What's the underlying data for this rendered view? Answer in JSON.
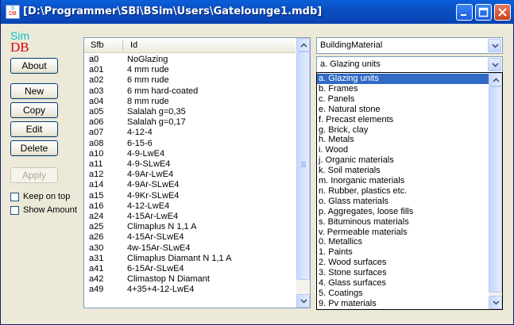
{
  "window": {
    "title": "[D:\\Programmer\\SBi\\BSim\\Users\\Gatelounge1.mdb]"
  },
  "logo": {
    "line1": "Sim",
    "line2": "DB"
  },
  "buttons": {
    "about": "About",
    "new": "New",
    "copy": "Copy",
    "edit": "Edit",
    "delete": "Delete",
    "apply": "Apply"
  },
  "checkboxes": {
    "keep_on_top": "Keep on top",
    "show_amount": "Show Amount"
  },
  "list": {
    "columns": [
      "Sfb",
      "Id"
    ],
    "rows": [
      [
        "a0",
        "NoGlazing"
      ],
      [
        "a01",
        "4 mm rude"
      ],
      [
        "a02",
        "6 mm rude"
      ],
      [
        "a03",
        "6 mm hard-coated"
      ],
      [
        "a04",
        "8 mm rude"
      ],
      [
        "a05",
        "Salalah g=0,35"
      ],
      [
        "a06",
        "Salalah g=0,17"
      ],
      [
        "a07",
        "4-12-4"
      ],
      [
        "a08",
        "6-15-6"
      ],
      [
        "a10",
        "4-9-LwE4"
      ],
      [
        "a11",
        "4-9-SLwE4"
      ],
      [
        "a12",
        "4-9Ar-LwE4"
      ],
      [
        "a14",
        "4-9Ar-SLwE4"
      ],
      [
        "a15",
        "4-9Kr-SLwE4"
      ],
      [
        "a16",
        "4-12-LwE4"
      ],
      [
        "a24",
        "4-15Ar-LwE4"
      ],
      [
        "a25",
        "Climaplus N 1,1 A"
      ],
      [
        "a26",
        "4-15Ar-SLwE4"
      ],
      [
        "a30",
        "4w-15Ar-SLwE4"
      ],
      [
        "a31",
        "Climaplus Diamant N 1,1 A"
      ],
      [
        "a41",
        "6-15Ar-SLwE4"
      ],
      [
        "a42",
        "Climastop N Diamant"
      ],
      [
        "a49",
        "4+35+4-12-LwE4"
      ]
    ]
  },
  "combo_table": {
    "value": "BuildingMaterial"
  },
  "combo_category": {
    "value": "a. Glazing units"
  },
  "dropdown": {
    "selected_index": 0,
    "options": [
      "a. Glazing units",
      "b. Frames",
      "c. Panels",
      "e. Natural stone",
      "f. Precast elements",
      "g. Brick, clay",
      "h. Metals",
      "i. Wood",
      "j. Organic materials",
      "k. Soil materials",
      "m. Inorganic materials",
      "n. Rubber, plastics etc.",
      "o. Glass materials",
      "p. Aggregates, loose fills",
      "s. Bituminous materials",
      "v. Permeable materials",
      "0. Metallics",
      "1. Paints",
      "2. Wood surfaces",
      "3. Stone surfaces",
      "4. Glass surfaces",
      "5. Coatings",
      "9. Pv materials"
    ]
  }
}
